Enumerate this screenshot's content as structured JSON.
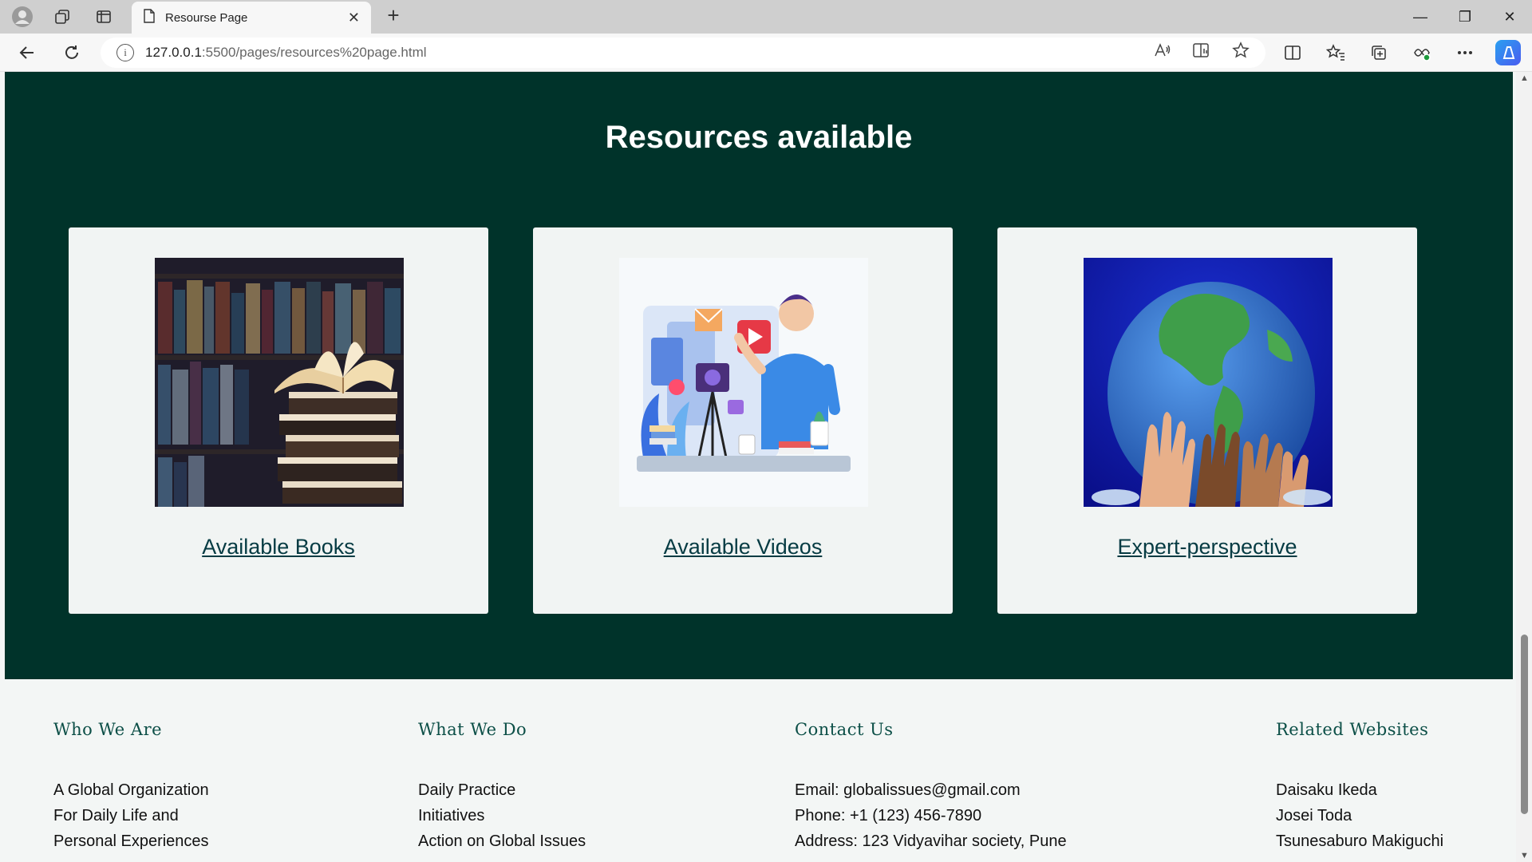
{
  "browser": {
    "tab_title": "Resourse Page",
    "url_host": "127.0.0.1",
    "url_path": ":5500/pages/resources%20page.html",
    "tab_close": "✕",
    "new_tab": "+",
    "icons": [
      "profile-icon",
      "workspaces-icon",
      "tab-actions-icon",
      "page-icon",
      "back-icon",
      "refresh-icon",
      "info-icon",
      "read-aloud-icon",
      "immersive-reader-icon",
      "favorite-star-icon",
      "split-screen-icon",
      "favorites-icon",
      "collections-icon",
      "browser-essentials-icon",
      "more-icon",
      "copilot-icon"
    ],
    "window_controls": [
      "—",
      "❐",
      "✕"
    ]
  },
  "resources": {
    "title": "Resources available",
    "background": "#00332a",
    "cards": [
      {
        "label": "Available Books",
        "image": "books-photo"
      },
      {
        "label": "Available Videos",
        "image": "video-creator-illustration"
      },
      {
        "label": "Expert-perspective",
        "image": "hands-holding-globe-photo"
      }
    ]
  },
  "footer": {
    "columns": [
      {
        "heading": "Who We Are",
        "items": [
          "A Global Organization",
          "For Daily Life and",
          "Personal Experiences"
        ]
      },
      {
        "heading": "What We Do",
        "items": [
          "Daily Practice",
          "Initiatives",
          "Action on Global Issues"
        ]
      },
      {
        "heading": "Contact Us",
        "items": [
          "Email: globalissues@gmail.com",
          "Phone: +1 (123) 456-7890",
          "Address: 123 Vidyavihar society, Pune"
        ]
      },
      {
        "heading": "Related Websites",
        "items": [
          "Daisaku Ikeda",
          "Josei Toda",
          "Tsunesaburo Makiguchi"
        ]
      }
    ]
  }
}
